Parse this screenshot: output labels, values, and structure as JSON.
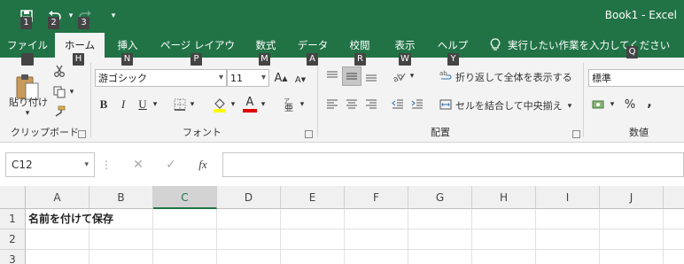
{
  "window": {
    "title": "Book1  -  Excel"
  },
  "qat": {
    "save_keytip": "1",
    "undo_keytip": "2",
    "redo_keytip": "3",
    "customize_symbol": "▾"
  },
  "tabs": [
    {
      "label": "ファイル",
      "keytip": "F"
    },
    {
      "label": "ホーム",
      "keytip": "H"
    },
    {
      "label": "挿入",
      "keytip": "N"
    },
    {
      "label": "ページ レイアウト",
      "keytip": "P"
    },
    {
      "label": "数式",
      "keytip": "M"
    },
    {
      "label": "データ",
      "keytip": "A"
    },
    {
      "label": "校閲",
      "keytip": "R"
    },
    {
      "label": "表示",
      "keytip": "W"
    },
    {
      "label": "ヘルプ",
      "keytip": "Y"
    }
  ],
  "tell_me": {
    "text": "実行したい作業を入力してください",
    "keytip": "Q"
  },
  "ribbon": {
    "clipboard": {
      "paste_label": "貼り付け",
      "group_label": "クリップボード"
    },
    "font": {
      "font_name": "游ゴシック",
      "font_size": "11",
      "bold": "B",
      "italic": "I",
      "underline": "U",
      "grow": "A",
      "shrink": "A",
      "font_color_letter": "A",
      "font_color": "#e00000",
      "highlight_color": "#ffff00",
      "group_label": "フォント"
    },
    "alignment": {
      "wrap_text": "折り返して全体を表示する",
      "merge_center": "セルを結合して中央揃え",
      "group_label": "配置"
    },
    "number": {
      "format": "標準",
      "percent": "%",
      "comma": ",",
      "group_label": "数値"
    }
  },
  "formula_bar": {
    "name_box": "C12",
    "fx": "fx",
    "cancel": "✕",
    "enter": "✓",
    "value": ""
  },
  "grid": {
    "columns": [
      "A",
      "B",
      "C",
      "D",
      "E",
      "F",
      "G",
      "H",
      "I",
      "J"
    ],
    "selected_column": "C",
    "rows": [
      {
        "num": "1",
        "A": "名前を付けて保存"
      },
      {
        "num": "2",
        "A": ""
      },
      {
        "num": "3",
        "A": ""
      }
    ]
  },
  "colors": {
    "accent": "#217346",
    "ribbon_bg": "#f3f3f3"
  }
}
